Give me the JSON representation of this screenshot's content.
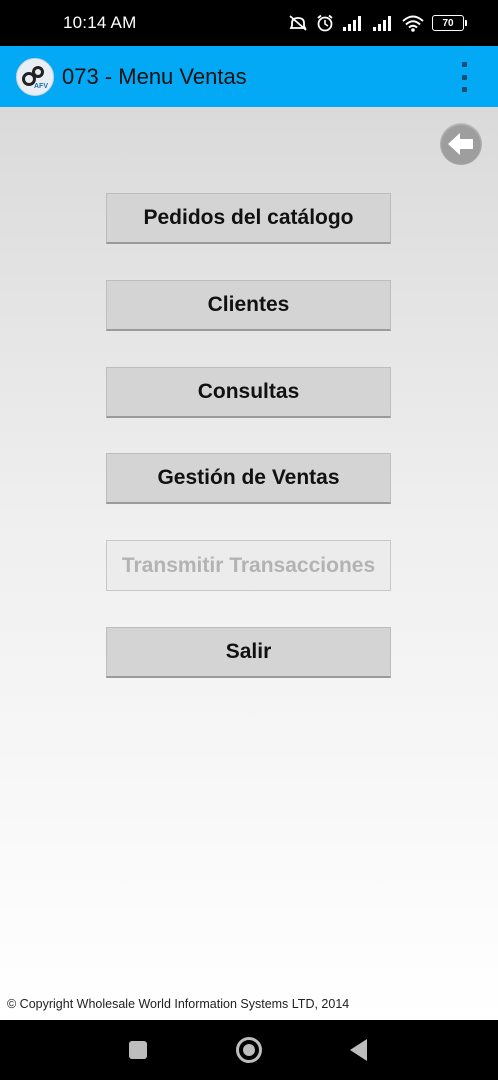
{
  "status_bar": {
    "time": "10:14 AM",
    "battery": "70",
    "icons": [
      "mute-icon",
      "alarm-icon",
      "signal-icon",
      "signal-icon",
      "wifi-icon",
      "battery-icon"
    ]
  },
  "action_bar": {
    "logo_text": "AFV",
    "title": "073 - Menu Ventas",
    "menu_icon": "overflow-menu-icon"
  },
  "content": {
    "back_icon": "back-arrow-icon",
    "buttons": [
      {
        "label": "Pedidos del catálogo",
        "enabled": true
      },
      {
        "label": "Clientes",
        "enabled": true
      },
      {
        "label": "Consultas",
        "enabled": true
      },
      {
        "label": "Gestión de Ventas",
        "enabled": true
      },
      {
        "label": "Transmitir Transacciones",
        "enabled": false
      },
      {
        "label": "Salir",
        "enabled": true
      }
    ],
    "copyright": "© Copyright Wholesale World Information Systems LTD, 2014"
  },
  "nav_bar": {
    "icons": [
      "recent-apps-icon",
      "home-icon",
      "back-icon"
    ]
  },
  "colors": {
    "action_bar": "#03a9f4",
    "button": "#d4d4d4",
    "button_disabled_text": "#b3b3b3"
  }
}
